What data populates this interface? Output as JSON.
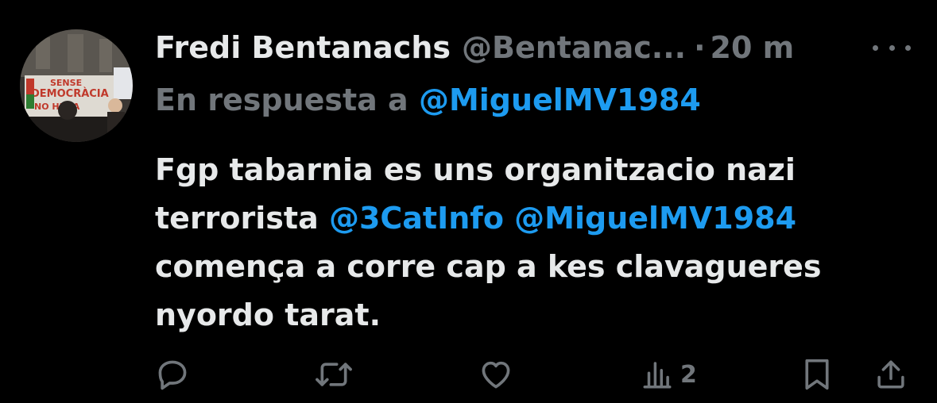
{
  "tweet": {
    "display_name": "Fredi Bentanachs",
    "handle": "@Bentanac...",
    "separator": "·",
    "time": "20 m",
    "reply_prefix": "En respuesta a",
    "reply_to": "@MiguelMV1984",
    "body": {
      "line1": "Fgp tabarnia es uns organitzacio nazi",
      "line2_text": "terrorista",
      "mention1": "@3CatInfo",
      "mention2": "@MiguelMV1984",
      "line3": "començа a corre cap a kes clavagueres",
      "line4": "nyordo tarat."
    },
    "avatar_banner_text_1": "SENSE",
    "avatar_banner_text_2": "DEMOCRÀCIA",
    "avatar_banner_text_3": "NO HI HA"
  },
  "actions": {
    "reply_icon": "reply-icon",
    "retweet_icon": "retweet-icon",
    "like_icon": "heart-icon",
    "views_icon": "views-icon",
    "views_count": "2",
    "bookmark_icon": "bookmark-icon",
    "share_icon": "share-icon"
  },
  "colors": {
    "background": "#000000",
    "text": "#e7e9ea",
    "secondary": "#71767b",
    "link": "#1d9bf0"
  }
}
